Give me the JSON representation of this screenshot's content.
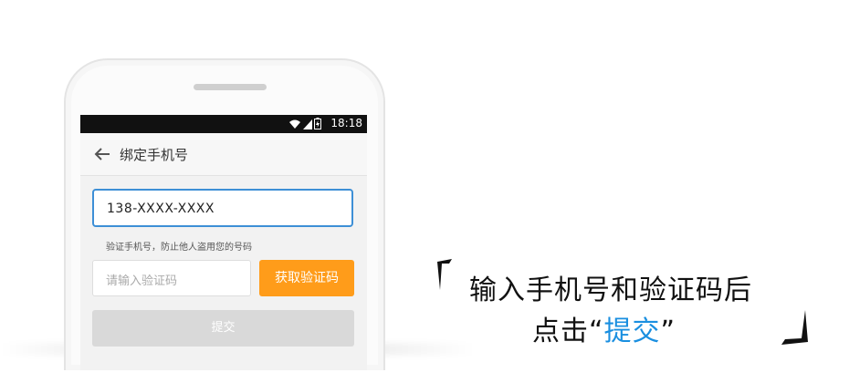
{
  "phone": {
    "status_time": "18:18",
    "app_title": "绑定手机号",
    "phone_value": "138-XXXX-XXXX",
    "hint_text": "验证手机号，防止他人盗用您的号码",
    "code_placeholder": "请输入验证码",
    "get_code_label": "获取验证码",
    "submit_label": "提交"
  },
  "caption": {
    "line1": "输入手机号和验证码后",
    "line2_prefix": "点击",
    "quote_open": "“",
    "highlight": "提交",
    "quote_close": "”"
  },
  "colors": {
    "accent_blue": "#1a8fe0",
    "input_focus_border": "#3d8fd6",
    "get_code_button": "#ff9c1a",
    "submit_disabled": "#d9d9d9"
  },
  "icons": [
    "wifi-icon",
    "signal-icon",
    "battery-icon",
    "back-arrow-icon"
  ]
}
